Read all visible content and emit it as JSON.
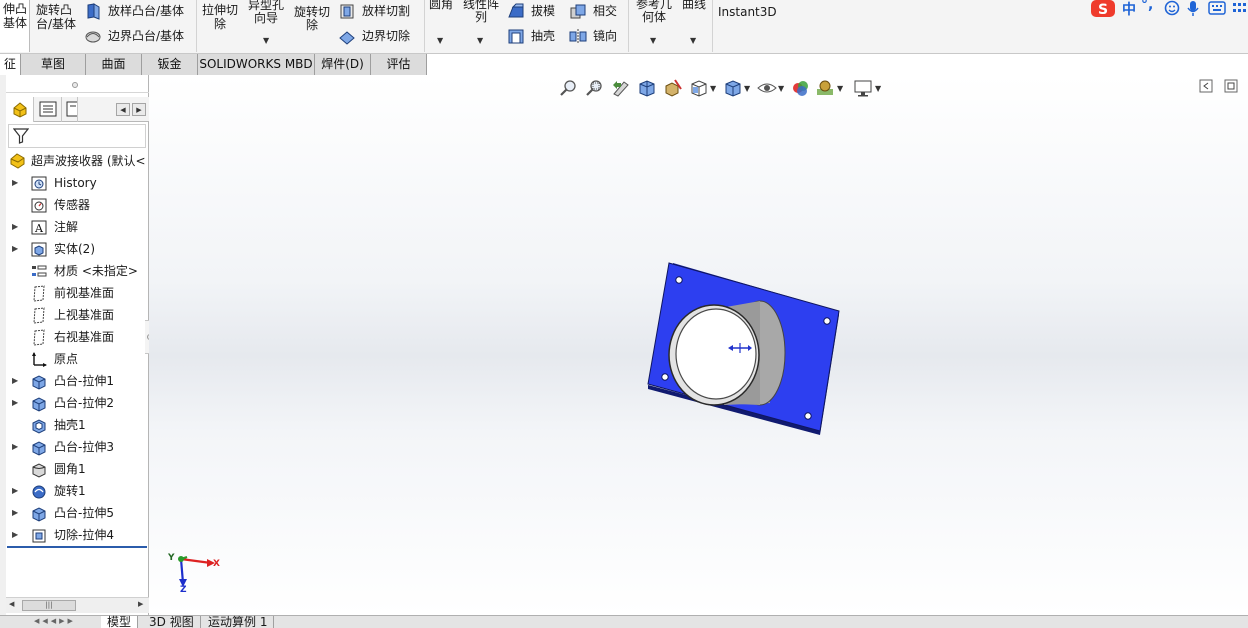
{
  "ribbon": {
    "extrude_boss": [
      "伸凸",
      "基体"
    ],
    "revolve_boss": [
      "旋转凸",
      "台/基体"
    ],
    "loft_boss": "放样凸台/基体",
    "boundary_boss": "边界凸台/基体",
    "extrude_cut": [
      "拉伸切",
      "除"
    ],
    "hole_wizard": [
      "异型孔",
      "向导"
    ],
    "revolve_cut": [
      "旋转切",
      "除"
    ],
    "loft_cut": "放样切割",
    "boundary_cut": "边界切除",
    "fillet": "圆角",
    "linear_pattern": [
      "线性阵",
      "列"
    ],
    "draft": "拔模",
    "shell": "抽壳",
    "intersect": "相交",
    "mirror": "镜向",
    "ref_geometry": [
      "参考几",
      "何体"
    ],
    "curves": "曲线",
    "instant3d": "Instant3D"
  },
  "ime": {
    "mode": "中",
    "punct": "°,"
  },
  "tabs": [
    {
      "label": "征"
    },
    {
      "label": "草图"
    },
    {
      "label": "曲面"
    },
    {
      "label": "钣金"
    },
    {
      "label": "SOLIDWORKS MBD"
    },
    {
      "label": "焊件(D)"
    },
    {
      "label": "评估"
    }
  ],
  "tree": {
    "root": "超声波接收器 (默认<",
    "items": [
      {
        "label": "History",
        "expandable": true,
        "icon": "history-icon"
      },
      {
        "label": "传感器",
        "expandable": false,
        "icon": "sensor-icon"
      },
      {
        "label": "注解",
        "expandable": true,
        "icon": "annotation-icon"
      },
      {
        "label": "实体(2)",
        "expandable": true,
        "icon": "solid-bodies-icon"
      },
      {
        "label": "材质 <未指定>",
        "expandable": false,
        "icon": "material-icon"
      },
      {
        "label": "前视基准面",
        "expandable": false,
        "icon": "plane-icon"
      },
      {
        "label": "上视基准面",
        "expandable": false,
        "icon": "plane-icon"
      },
      {
        "label": "右视基准面",
        "expandable": false,
        "icon": "plane-icon"
      },
      {
        "label": "原点",
        "expandable": false,
        "icon": "origin-icon"
      },
      {
        "label": "凸台-拉伸1",
        "expandable": true,
        "icon": "boss-extrude-icon"
      },
      {
        "label": "凸台-拉伸2",
        "expandable": true,
        "icon": "boss-extrude-icon"
      },
      {
        "label": "抽壳1",
        "expandable": false,
        "icon": "shell-icon"
      },
      {
        "label": "凸台-拉伸3",
        "expandable": true,
        "icon": "boss-extrude-icon"
      },
      {
        "label": "圆角1",
        "expandable": false,
        "icon": "fillet-icon"
      },
      {
        "label": "旋转1",
        "expandable": true,
        "icon": "revolve-icon"
      },
      {
        "label": "凸台-拉伸5",
        "expandable": true,
        "icon": "boss-extrude-icon"
      },
      {
        "label": "切除-拉伸4",
        "expandable": true,
        "icon": "cut-extrude-icon"
      }
    ]
  },
  "triad": {
    "x": "X",
    "y": "Y",
    "z": "Z"
  },
  "bottom_tabs": [
    {
      "label": "模型",
      "active": true
    },
    {
      "label": "3D 视图",
      "active": false
    },
    {
      "label": "运动算例 1",
      "active": false
    }
  ],
  "colors": {
    "plate": "#2d3ff0",
    "selection": "#2b5cab"
  }
}
